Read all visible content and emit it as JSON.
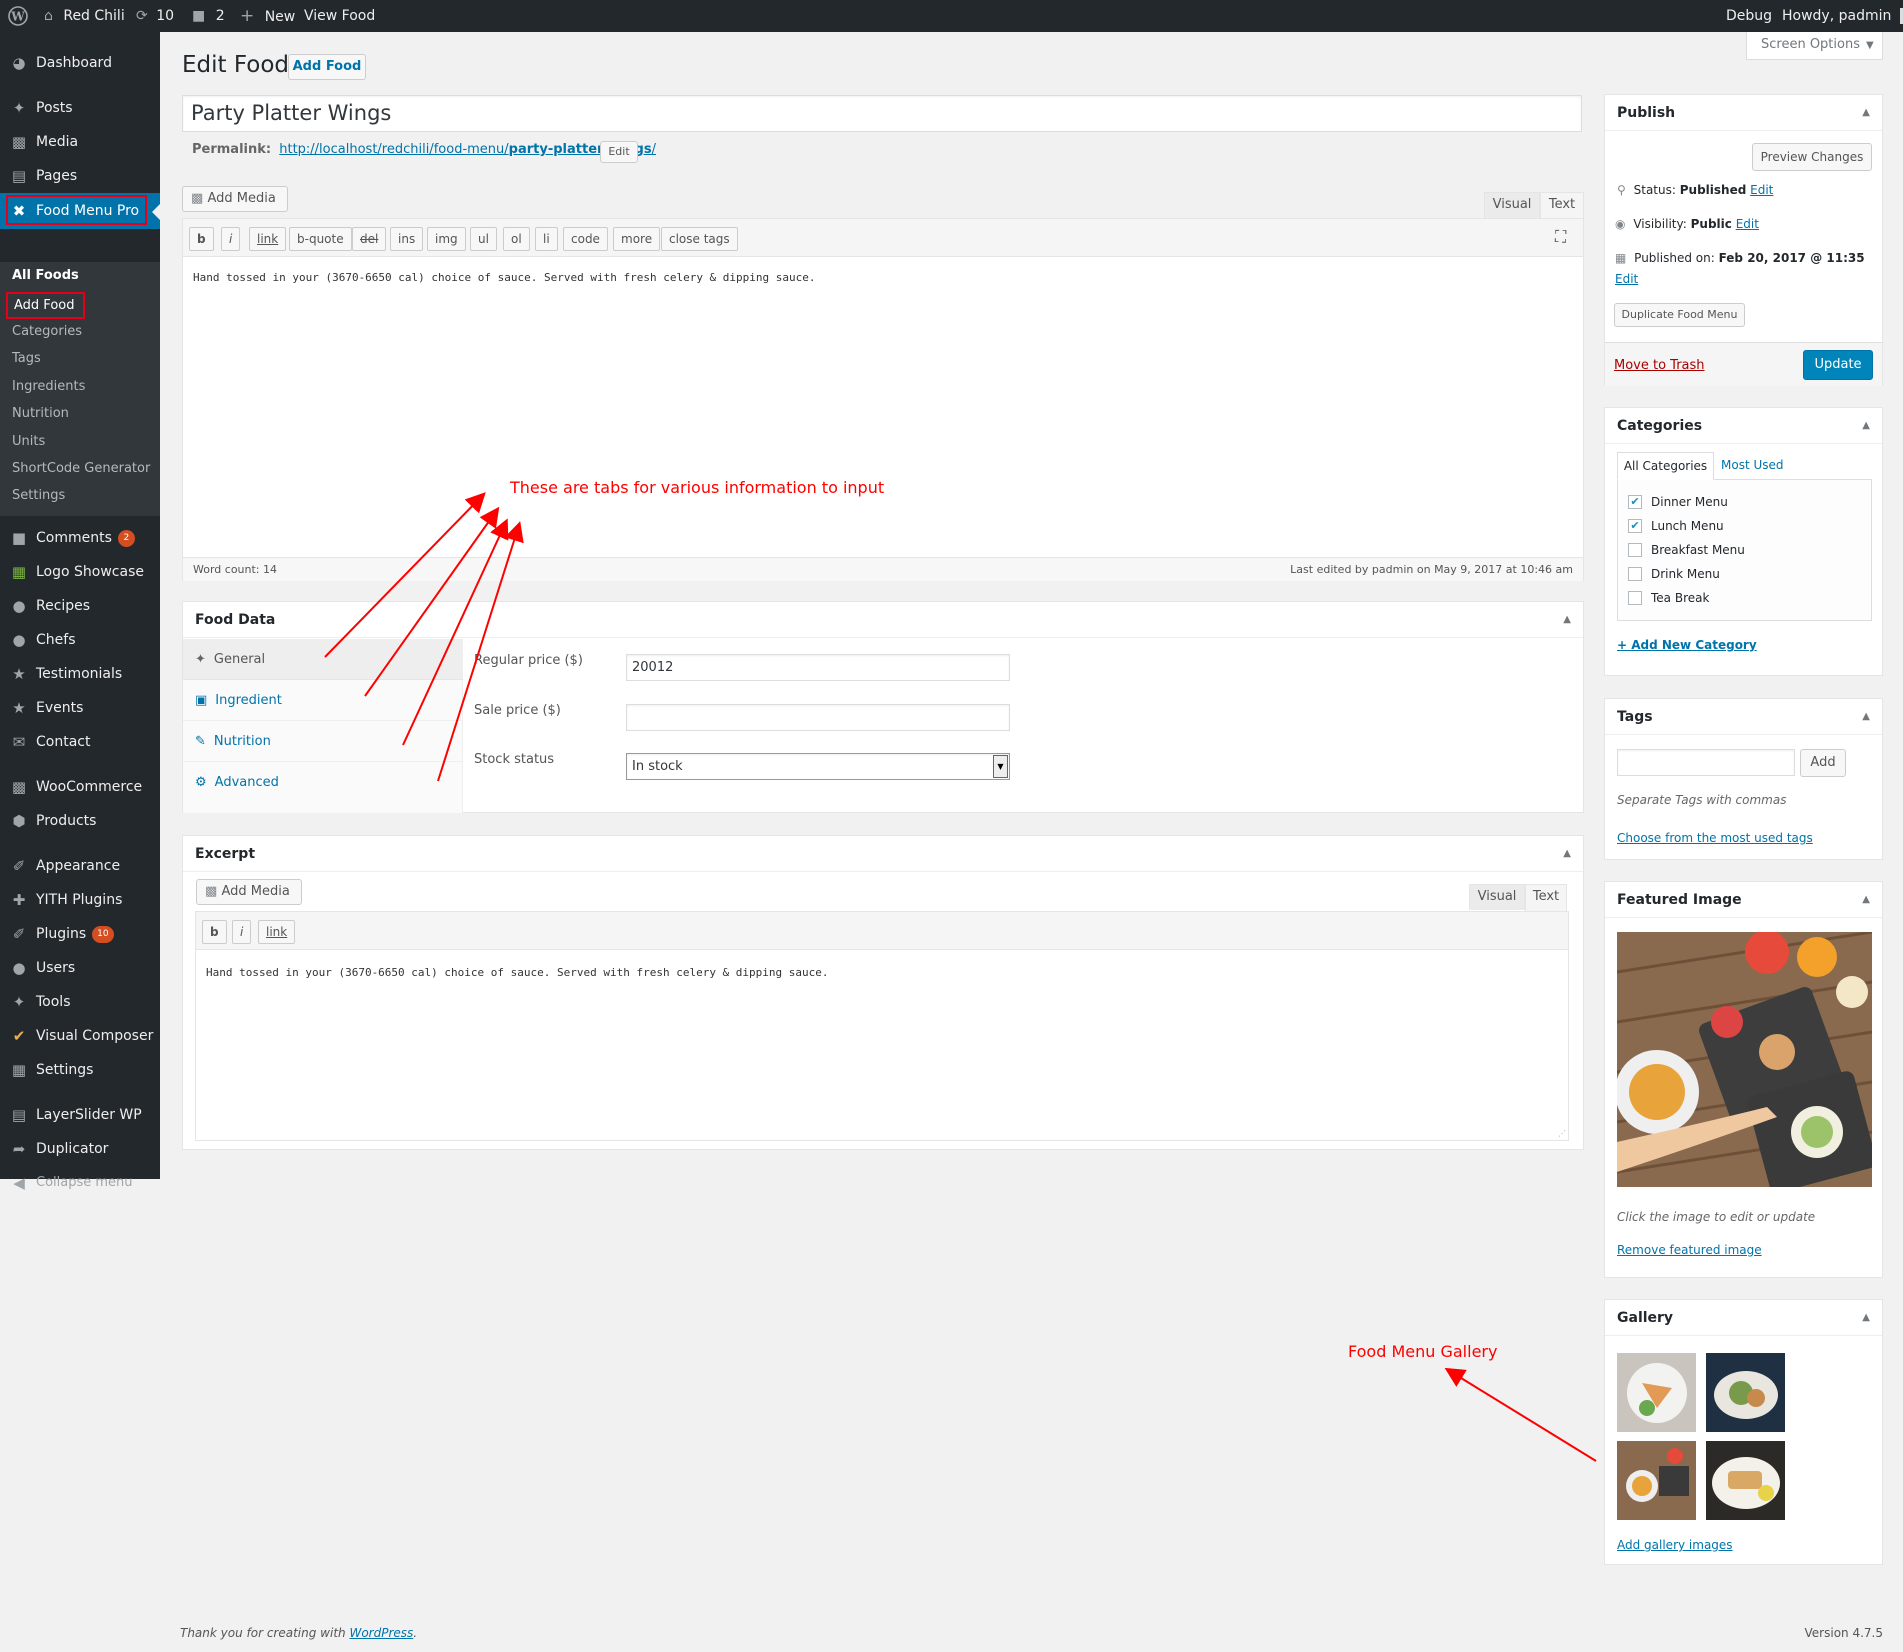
{
  "admin_bar": {
    "site_name": "Red Chili",
    "updates_count": "10",
    "comments_count": "2",
    "new_label": "New",
    "view_label": "View Food",
    "debug_label": "Debug",
    "howdy": "Howdy, padmin"
  },
  "menu": {
    "dashboard": "Dashboard",
    "posts": "Posts",
    "media": "Media",
    "pages": "Pages",
    "food_menu_pro": "Food Menu Pro",
    "submenu": [
      "All Foods",
      "Add Food",
      "Categories",
      "Tags",
      "Ingredients",
      "Nutrition",
      "Units",
      "ShortCode Generator",
      "Settings"
    ],
    "comments": "Comments",
    "comments_badge": "2",
    "logo_showcase": "Logo Showcase",
    "recipes": "Recipes",
    "chefs": "Chefs",
    "testimonials": "Testimonials",
    "events": "Events",
    "contact": "Contact",
    "woocommerce": "WooCommerce",
    "products": "Products",
    "appearance": "Appearance",
    "yith": "YITH Plugins",
    "plugins": "Plugins",
    "plugins_badge": "10",
    "users": "Users",
    "tools": "Tools",
    "visual_composer": "Visual Composer",
    "settings": "Settings",
    "layerslider": "LayerSlider WP",
    "duplicator": "Duplicator",
    "collapse": "Collapse menu"
  },
  "page": {
    "title": "Edit Food",
    "add_new": "Add Food",
    "screen_options": "Screen Options",
    "post_title": "Party Platter Wings",
    "permalink_label": "Permalink:",
    "permalink_base": "http://localhost/redchili/food-menu/",
    "permalink_slug": "party-platter-wings",
    "permalink_end": "/",
    "permalink_edit": "Edit"
  },
  "editor": {
    "add_media": "Add Media",
    "tab_visual": "Visual",
    "tab_text": "Text",
    "quicktags": [
      "b",
      "i",
      "link",
      "b-quote",
      "del",
      "ins",
      "img",
      "ul",
      "ol",
      "li",
      "code",
      "more",
      "close tags"
    ],
    "content": "Hand tossed in your (3670-6650 cal) choice of sauce. Served with fresh celery & dipping sauce.",
    "word_count": "Word count: 14",
    "last_edited": "Last edited by padmin on May 9, 2017 at 10:46 am"
  },
  "annotations": {
    "tabs_note": "These are tabs for various information to input",
    "gallery_note": "Food Menu Gallery"
  },
  "food_data": {
    "title": "Food Data",
    "tabs": [
      "General",
      "Ingredient",
      "Nutrition",
      "Advanced"
    ],
    "regular_price_label": "Regular price ($)",
    "regular_price_value": "20012",
    "sale_price_label": "Sale price ($)",
    "sale_price_value": "",
    "stock_label": "Stock status",
    "stock_value": "In stock"
  },
  "excerpt": {
    "title": "Excerpt",
    "add_media": "Add Media",
    "tab_visual": "Visual",
    "tab_text": "Text",
    "quicktags": [
      "b",
      "i",
      "link"
    ],
    "content": "Hand tossed in your (3670-6650 cal) choice of sauce. Served with fresh celery & dipping sauce."
  },
  "publish": {
    "title": "Publish",
    "preview": "Preview Changes",
    "status_label": "Status:",
    "status_value": "Published",
    "visibility_label": "Visibility:",
    "visibility_value": "Public",
    "published_label": "Published on:",
    "published_value": "Feb 20, 2017 @ 11:35",
    "edit": "Edit",
    "duplicate": "Duplicate Food Menu",
    "trash": "Move to Trash",
    "update": "Update"
  },
  "categories": {
    "title": "Categories",
    "tab_all": "All Categories",
    "tab_used": "Most Used",
    "items": [
      {
        "label": "Dinner Menu",
        "checked": true
      },
      {
        "label": "Lunch Menu",
        "checked": true
      },
      {
        "label": "Breakfast Menu",
        "checked": false
      },
      {
        "label": "Drink Menu",
        "checked": false
      },
      {
        "label": "Tea Break",
        "checked": false
      }
    ],
    "add_new": "+ Add New Category"
  },
  "tags": {
    "title": "Tags",
    "add": "Add",
    "hint": "Separate Tags with commas",
    "choose": "Choose from the most used tags"
  },
  "featured": {
    "title": "Featured Image",
    "hint": "Click the image to edit or update",
    "remove": "Remove featured image"
  },
  "gallery": {
    "title": "Gallery",
    "add": "Add gallery images"
  },
  "footer": {
    "thanks": "Thank you for creating with",
    "wp": "WordPress",
    "dot": ".",
    "version": "Version 4.7.5"
  }
}
